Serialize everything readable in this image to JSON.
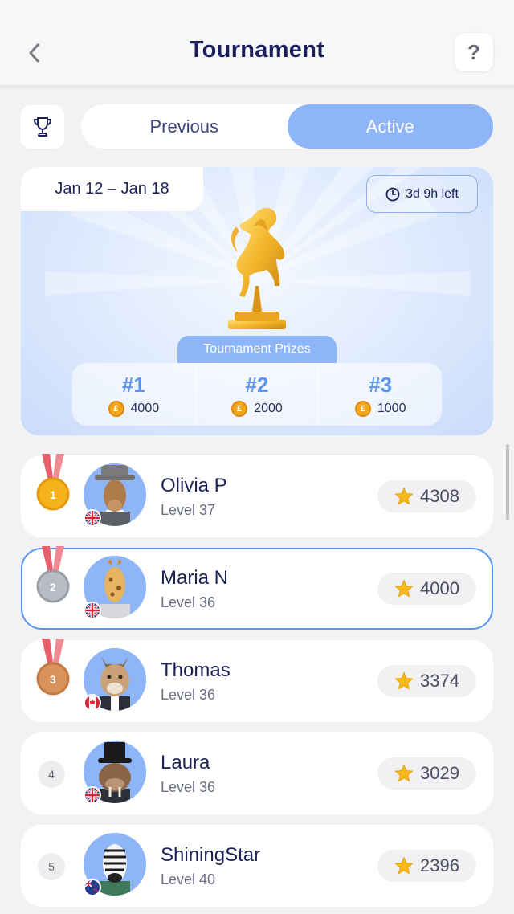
{
  "header": {
    "title": "Tournament",
    "back_icon": "chevron-left-icon",
    "help_label": "?"
  },
  "tabs": {
    "trophy_icon": "trophy-icon",
    "items": [
      {
        "label": "Previous",
        "active": false
      },
      {
        "label": "Active",
        "active": true
      }
    ]
  },
  "prize_card": {
    "date_range": "Jan 12 – Jan 18",
    "time_left": "3d 9h left",
    "section_label": "Tournament Prizes",
    "image": "golden-horse-trophy",
    "prizes": [
      {
        "rank": "#1",
        "amount": "4000"
      },
      {
        "rank": "#2",
        "amount": "2000"
      },
      {
        "rank": "#3",
        "amount": "1000"
      }
    ],
    "coin_symbol": "£"
  },
  "leaderboard": [
    {
      "rank": "1",
      "name": "Olivia P",
      "level": "Level 37",
      "score": "4308",
      "flag": "uk",
      "avatar": "camel-cowboy",
      "medal": "gold"
    },
    {
      "rank": "2",
      "name": "Maria N",
      "level": "Level 36",
      "score": "4000",
      "flag": "uk",
      "avatar": "giraffe",
      "medal": "silver",
      "highlighted": true
    },
    {
      "rank": "3",
      "name": "Thomas",
      "level": "Level 36",
      "score": "3374",
      "flag": "canada",
      "avatar": "lynx",
      "medal": "bronze"
    },
    {
      "rank": "4",
      "name": "Laura",
      "level": "Level 36",
      "score": "3029",
      "flag": "uk",
      "avatar": "walrus-top-hat"
    },
    {
      "rank": "5",
      "name": "ShiningStar",
      "level": "Level 40",
      "score": "2396",
      "flag": "new-zealand",
      "avatar": "zebra"
    }
  ],
  "colors": {
    "accent": "#8fb5f9",
    "highlight_border": "#5a95f0",
    "gold": "#f4b31b",
    "silver": "#b8bcc4",
    "bronze": "#d9925a"
  }
}
